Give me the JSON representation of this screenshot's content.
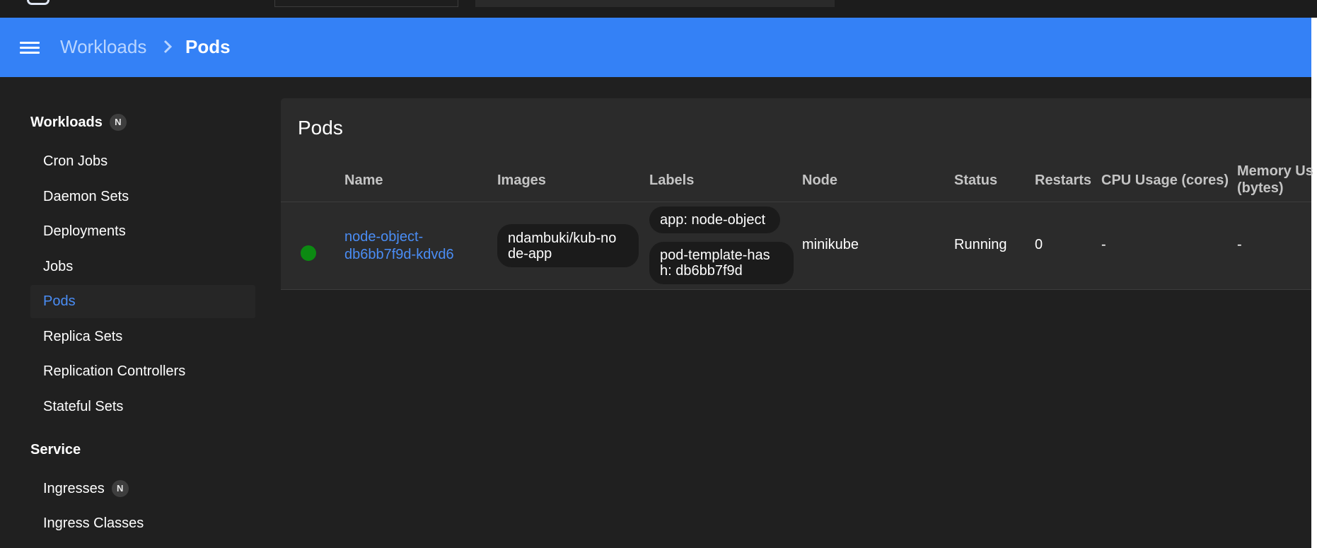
{
  "breadcrumb": {
    "parent": "Workloads",
    "current": "Pods"
  },
  "sidebar": {
    "workloads_section": {
      "label": "Workloads",
      "badge": "N"
    },
    "items": [
      {
        "label": "Cron Jobs"
      },
      {
        "label": "Daemon Sets"
      },
      {
        "label": "Deployments"
      },
      {
        "label": "Jobs"
      },
      {
        "label": "Pods",
        "active": true
      },
      {
        "label": "Replica Sets"
      },
      {
        "label": "Replication Controllers"
      },
      {
        "label": "Stateful Sets"
      }
    ],
    "service_section": {
      "label": "Service"
    },
    "service_items": [
      {
        "label": "Ingresses",
        "badge": "N"
      },
      {
        "label": "Ingress Classes"
      }
    ]
  },
  "pods": {
    "title": "Pods",
    "columns": {
      "name": "Name",
      "images": "Images",
      "labels": "Labels",
      "node": "Node",
      "status": "Status",
      "restarts": "Restarts",
      "cpu": "CPU Usage (cores)",
      "memory_line1": "Memory Us",
      "memory_line2": "(bytes)"
    },
    "rows": [
      {
        "name_line1": "node-object-",
        "name_line2": "db6bb7f9d-kdvd6",
        "image_line1": "ndambuki/kub-no",
        "image_line2": "de-app",
        "label1": "app: node-object",
        "label2_line1": "pod-template-has",
        "label2_line2": "h: db6bb7f9d",
        "node": "minikube",
        "status": "Running",
        "status_color": "#0c8a12",
        "restarts": "0",
        "cpu": "-",
        "memory": "-"
      }
    ]
  },
  "colors": {
    "header": "#3481f6",
    "link": "#4a8df5",
    "background": "#202020",
    "card": "#2b2b2b"
  },
  "icons": {
    "menu": "hamburger-menu-icon",
    "separator": "chevron-right-icon",
    "status": "status-running-icon"
  }
}
